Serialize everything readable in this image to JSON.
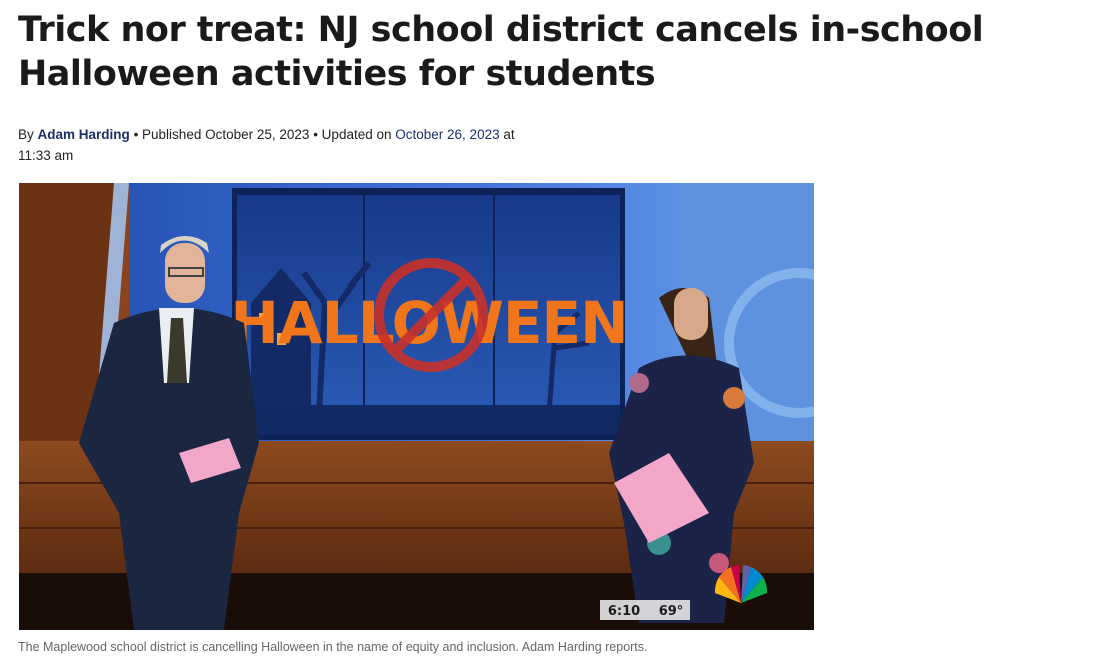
{
  "article": {
    "headline": "Trick nor treat: NJ school district cancels in-school Halloween activities for students",
    "byline": {
      "by_prefix": "By",
      "author": "Adam Harding",
      "published_label": "• Published",
      "published_date": "October 25, 2023",
      "updated_label": "• Updated on",
      "updated_date": "October 26, 2023",
      "updated_at": "at",
      "updated_time": "11:33 am"
    },
    "media": {
      "screen_text": "HALLOWEEN",
      "bug_time": "6:10",
      "bug_temp": "69°",
      "logo": "nbc-peacock-logo",
      "no_symbol": "prohibition-icon"
    },
    "caption": "The Maplewood school district is cancelling Halloween in the name of equity and inclusion. Adam Harding reports."
  },
  "colors": {
    "headline": "#1a1a1a",
    "link": "#1b2f6b",
    "studio_blue": "#2e5fc4",
    "desk_wood": "#7a3a16",
    "halloween_orange": "#f0751b",
    "no_sign_red": "#c8312a"
  }
}
